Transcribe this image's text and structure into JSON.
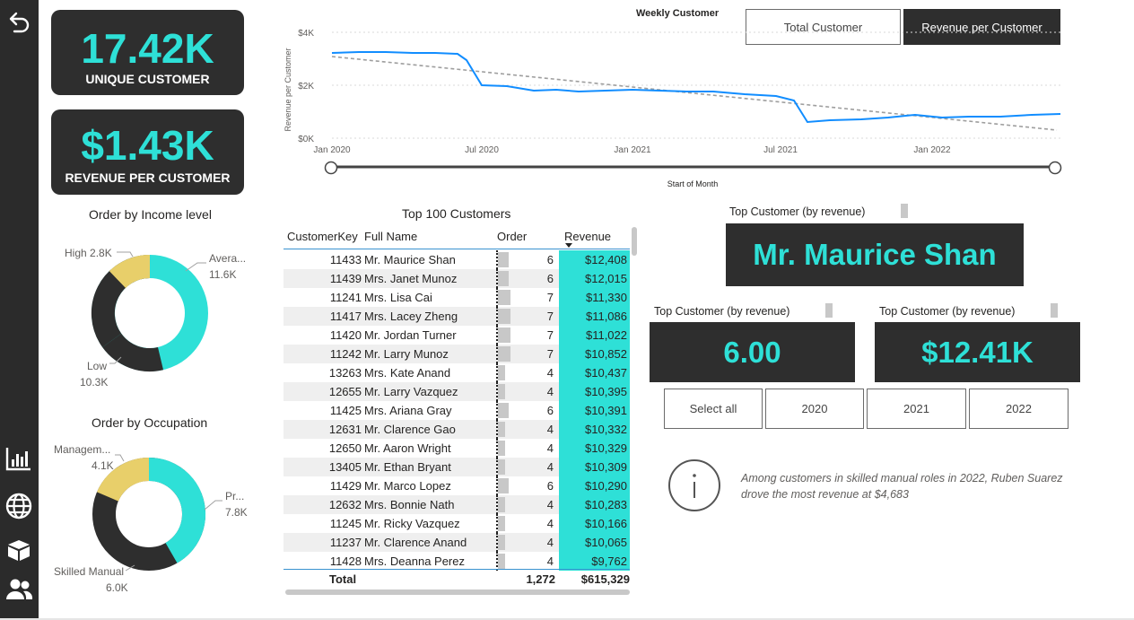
{
  "sidebar": {
    "icons": [
      "back-arrow-icon",
      "bar-chart-icon",
      "globe-icon",
      "box-icon",
      "users-icon"
    ]
  },
  "kpi": {
    "unique_customer_value": "17.42K",
    "unique_customer_label": "UNIQUE CUSTOMER",
    "revenue_per_customer_value": "$1.43K",
    "revenue_per_customer_label": "REVENUE PER CUSTOMER"
  },
  "weekly_chart": {
    "title": "Weekly Customer",
    "toggle": [
      "Total Customer",
      "Revenue per Customer"
    ],
    "active_toggle": "Revenue per Customer",
    "ylabel": "Revenue per Customer",
    "xlabel": "Start of Month",
    "y_ticks": [
      "$4K",
      "$2K",
      "$0K"
    ],
    "x_ticks": [
      "Jan 2020",
      "Jul 2020",
      "Jan 2021",
      "Jul 2021",
      "Jan 2022"
    ]
  },
  "income_chart": {
    "title": "Order by Income level",
    "labels": [
      {
        "name": "High",
        "value": "2.8K"
      },
      {
        "name": "Avera...",
        "value": "11.6K"
      },
      {
        "name": "Low",
        "value": "10.3K"
      }
    ]
  },
  "occupation_chart": {
    "title": "Order by Occupation",
    "labels": [
      {
        "name": "Managem...",
        "value": "4.1K"
      },
      {
        "name": "Pr...",
        "value": "7.8K"
      },
      {
        "name": "Skilled Manual",
        "value": "6.0K"
      }
    ]
  },
  "table": {
    "title": "Top 100 Customers",
    "headers": [
      "CustomerKey",
      "Full Name",
      "Order",
      "Revenue"
    ],
    "rows": [
      [
        "11433",
        "Mr. Maurice Shan",
        "6",
        "$12,408"
      ],
      [
        "11439",
        "Mrs. Janet Munoz",
        "6",
        "$12,015"
      ],
      [
        "11241",
        "Mrs. Lisa Cai",
        "7",
        "$11,330"
      ],
      [
        "11417",
        "Mrs. Lacey Zheng",
        "7",
        "$11,086"
      ],
      [
        "11420",
        "Mr. Jordan Turner",
        "7",
        "$11,022"
      ],
      [
        "11242",
        "Mr. Larry Munoz",
        "7",
        "$10,852"
      ],
      [
        "13263",
        "Mrs. Kate Anand",
        "4",
        "$10,437"
      ],
      [
        "12655",
        "Mr. Larry Vazquez",
        "4",
        "$10,395"
      ],
      [
        "11425",
        "Mrs. Ariana Gray",
        "6",
        "$10,391"
      ],
      [
        "12631",
        "Mr. Clarence Gao",
        "4",
        "$10,332"
      ],
      [
        "12650",
        "Mr. Aaron Wright",
        "4",
        "$10,329"
      ],
      [
        "13405",
        "Mr. Ethan Bryant",
        "4",
        "$10,309"
      ],
      [
        "11429",
        "Mr. Marco Lopez",
        "6",
        "$10,290"
      ],
      [
        "12632",
        "Mrs. Bonnie Nath",
        "4",
        "$10,283"
      ],
      [
        "11245",
        "Mr. Ricky Vazquez",
        "4",
        "$10,166"
      ],
      [
        "11237",
        "Mr. Clarence Anand",
        "4",
        "$10,065"
      ],
      [
        "11428",
        "Mrs. Deanna Perez",
        "4",
        "$9,762"
      ]
    ],
    "total_label": "Total",
    "total_orders": "1,272",
    "total_revenue": "$615,329"
  },
  "top_customer": {
    "title": "Top Customer (by revenue)",
    "name": "Mr. Maurice Shan",
    "orders_title": "Top Customer (by revenue)",
    "orders_value": "6.00",
    "revenue_title": "Top Customer (by revenue)",
    "revenue_value": "$12.41K"
  },
  "year_filter": [
    "Select all",
    "2020",
    "2021",
    "2022"
  ],
  "insight": {
    "icon": "info-icon",
    "text": "Among customers in skilled manual roles in 2022, Ruben Suarez drove the most revenue at $4,683"
  },
  "colors": {
    "accent": "#2ee0d7",
    "dark": "#2e2e2e",
    "line": "#118dff",
    "yellow": "#e8cf6a"
  }
}
